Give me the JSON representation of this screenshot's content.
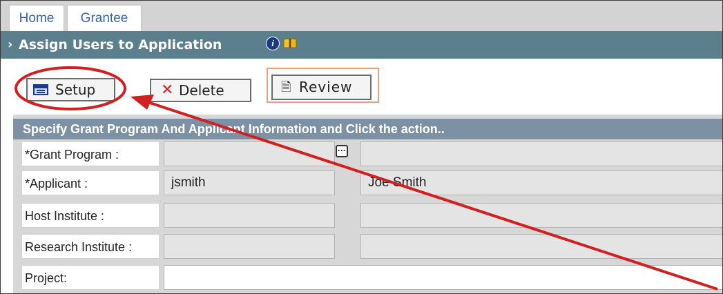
{
  "tabs": [
    {
      "label": "Home"
    },
    {
      "label": "Grantee"
    }
  ],
  "titlebar": {
    "title": "Assign Users to Application",
    "info_icon_glyph": "i",
    "icons": [
      "info-icon",
      "book-icon"
    ]
  },
  "actions": {
    "setup_label": "Setup",
    "delete_label": "Delete",
    "delete_glyph": "✕",
    "review_label": "Review",
    "review_glyph": "🗎"
  },
  "form": {
    "header": "Specify Grant Program And Applicant Information and Click the action..",
    "rows": [
      {
        "label": "*Grant Program :",
        "value": "",
        "value2": ""
      },
      {
        "label": "*Applicant :",
        "value": "jsmith",
        "value2": "Joe Smith"
      },
      {
        "label": "Host Institute :",
        "value": "",
        "value2": ""
      },
      {
        "label": "Research Institute :",
        "value": "",
        "value2": ""
      },
      {
        "label": "Project:",
        "value": ""
      }
    ],
    "lookup_glyph": "···"
  },
  "annotation": {
    "color": "#d31f1f",
    "shapes": [
      "circle around Setup button",
      "arrow pointing to Setup button"
    ]
  },
  "colors": {
    "titlebar": "#5b7f8d",
    "panel_header": "#7d91a4",
    "tab_text": "#3a63a8",
    "review_outline": "#e8a07f"
  }
}
